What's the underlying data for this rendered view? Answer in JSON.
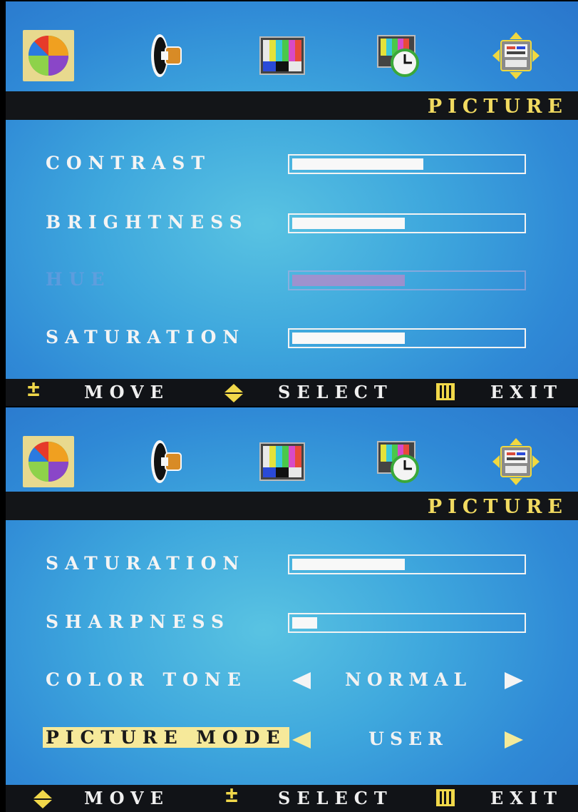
{
  "screens": [
    {
      "title": "PICTURE",
      "icons": [
        "color-wheel-icon",
        "speaker-icon",
        "color-bars-icon",
        "clock-icon",
        "setup-icon"
      ],
      "rows": [
        {
          "label": "CONTRAST",
          "type": "slider",
          "level": 0.57
        },
        {
          "label": "BRIGHTNESS",
          "type": "slider",
          "level": 0.49
        },
        {
          "label": "HUE",
          "type": "slider",
          "level": 0.49,
          "disabled": true
        },
        {
          "label": "SATURATION",
          "type": "slider",
          "level": 0.49
        }
      ],
      "footer": {
        "move": "MOVE",
        "select": "SELECT",
        "exit": "EXIT"
      }
    },
    {
      "title": "PICTURE",
      "icons": [
        "color-wheel-icon",
        "speaker-icon",
        "color-bars-icon",
        "clock-icon",
        "setup-icon"
      ],
      "rows": [
        {
          "label": "SATURATION",
          "type": "slider",
          "level": 0.49
        },
        {
          "label": "SHARPNESS",
          "type": "slider",
          "level": 0.11
        },
        {
          "label": "COLOR TONE",
          "type": "option",
          "value": "NORMAL"
        },
        {
          "label": "PICTURE MODE",
          "type": "option",
          "value": "USER",
          "selected": true
        }
      ],
      "footer": {
        "move": "MOVE",
        "select": "SELECT",
        "exit": "EXIT"
      }
    }
  ],
  "colors": {
    "accent": "#f1da60",
    "bar": "#131518",
    "highlight": "#f6e99a"
  }
}
